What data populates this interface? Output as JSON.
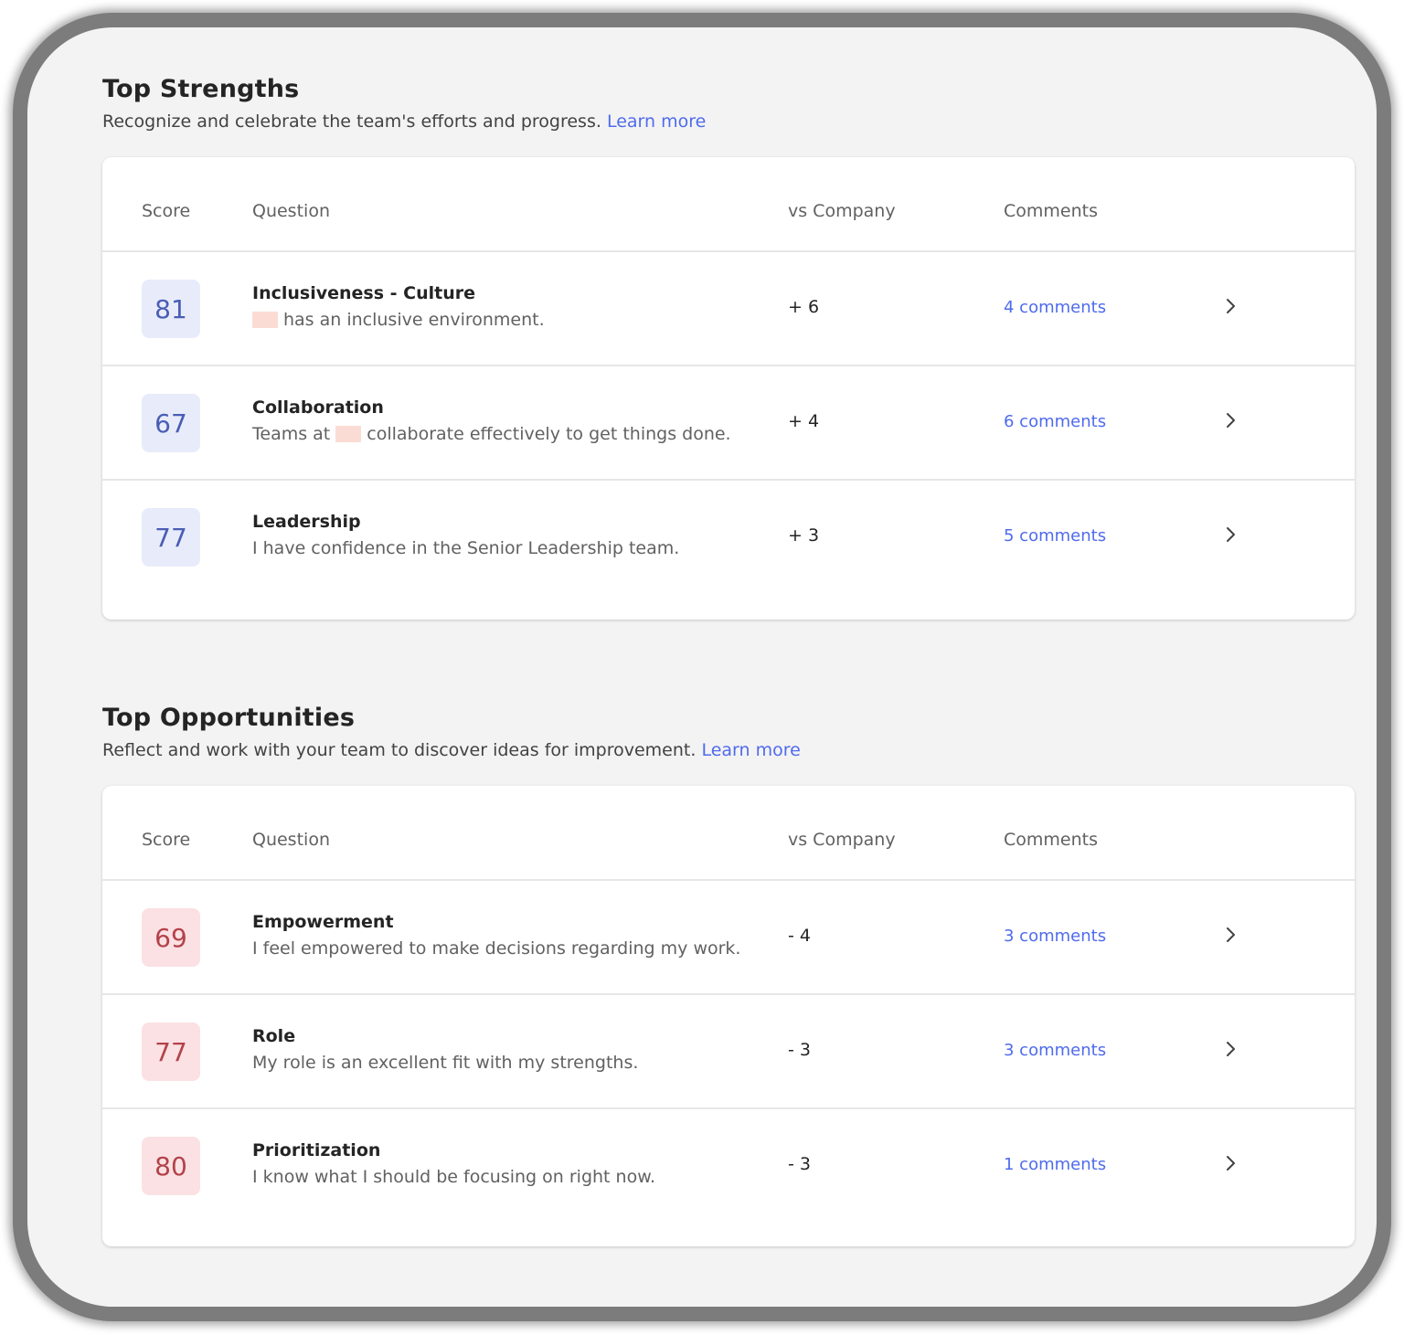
{
  "colors": {
    "link": "#4f6bed",
    "positive_badge_bg": "#e8ecfa",
    "positive_badge_text": "#4a5db5",
    "negative_badge_bg": "#fbe1e4",
    "negative_badge_text": "#b4424a"
  },
  "icons": {
    "row_arrow": "chevron-right-icon"
  },
  "strengths": {
    "title": "Top Strengths",
    "subtitle": "Recognize and celebrate the team's efforts and progress.",
    "learn_more": "Learn more",
    "headers": {
      "score": "Score",
      "question": "Question",
      "vs": "vs Company",
      "comments": "Comments"
    },
    "rows": [
      {
        "score": "81",
        "title": "Inclusiveness - Culture",
        "desc_before": "",
        "desc_after": "has an inclusive environment.",
        "vs": "+ 6",
        "comments": "4 comments"
      },
      {
        "score": "67",
        "title": "Collaboration",
        "desc_before": "Teams at",
        "desc_after": "collaborate effectively to get things done.",
        "vs": "+ 4",
        "comments": "6 comments"
      },
      {
        "score": "77",
        "title": "Leadership",
        "desc": "I have confidence in the Senior Leadership team.",
        "vs": "+ 3",
        "comments": "5 comments"
      }
    ]
  },
  "opportunities": {
    "title": "Top Opportunities",
    "subtitle": "Reflect and work with your team to discover ideas for improvement.",
    "learn_more": "Learn more",
    "headers": {
      "score": "Score",
      "question": "Question",
      "vs": "vs Company",
      "comments": "Comments"
    },
    "rows": [
      {
        "score": "69",
        "title": "Empowerment",
        "desc": "I feel empowered to make decisions regarding my work.",
        "vs": "- 4",
        "comments": "3 comments"
      },
      {
        "score": "77",
        "title": "Role",
        "desc": "My role is an excellent fit with my strengths.",
        "vs": "- 3",
        "comments": "3 comments"
      },
      {
        "score": "80",
        "title": "Prioritization",
        "desc": "I know what I should be focusing on right now.",
        "vs": "- 3",
        "comments": "1 comments"
      }
    ]
  }
}
